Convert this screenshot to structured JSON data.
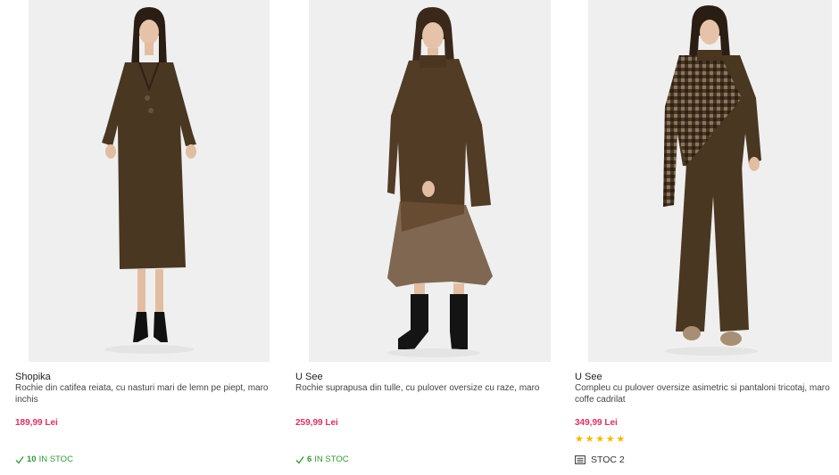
{
  "products": [
    {
      "brand": "Shopika",
      "title": "Rochie din catifea reiata, cu nasturi mari de lemn pe piept, maro inchis",
      "price": "189,99 Lei",
      "stock_qty": "10",
      "stock_label": "IN STOC",
      "image": "woman in long dark brown corduroy dress with black lace-up heels"
    },
    {
      "brand": "U See",
      "title": "Rochie suprapusa din tulle, cu pulover oversize cu raze, maro",
      "price": "259,99 Lei",
      "stock_qty": "6",
      "stock_label": "IN STOC",
      "image": "woman in brown oversize sweater over tulle skirt with black boots"
    },
    {
      "brand": "U See",
      "title": "Compleu cu pulover oversize asimetric si pantaloni tricotaj, maro coffe cadrilat",
      "price": "349,99 Lei",
      "rating": 5,
      "stock_text": "STOC 2",
      "image": "woman in brown asymmetric checked knit set"
    }
  ],
  "colors": {
    "price": "#d6335f",
    "in_stock": "#2f9a36",
    "star": "#f5b800",
    "garment_brown": "#4a3722"
  },
  "icons": {
    "in_stock": "check-icon",
    "rating": "star-icon",
    "stock_list": "list-icon"
  }
}
